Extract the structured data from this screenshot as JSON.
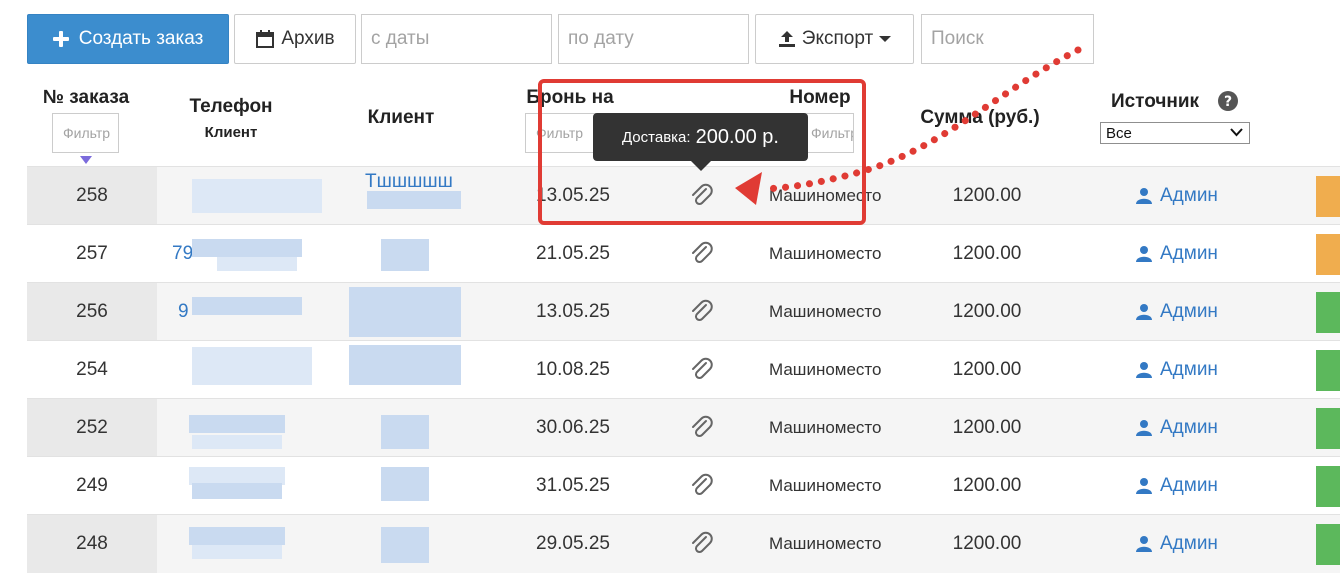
{
  "toolbar": {
    "create_label": "Создать заказ",
    "archive_label": "Архив",
    "date_from_placeholder": "с даты",
    "date_to_placeholder": "по дату",
    "export_label": "Экспорт",
    "search_placeholder": "Поиск"
  },
  "table": {
    "headers": {
      "order_no": "№ заказа",
      "phone": "Телефон",
      "phone_sub": "Клиент",
      "client": "Клиент",
      "booking": "Бронь на",
      "number": "Номер",
      "sum": "Сумма (руб.)",
      "source": "Источник"
    },
    "filter_placeholder": "Фильтр",
    "source_select_value": "Все",
    "rows": [
      {
        "id": "258",
        "phone": "",
        "client": "Тшшшшш",
        "date": "13.05.25",
        "place": "Машиноместо",
        "sum": "1200.00",
        "source": "Админ",
        "status_color": "#f0ad4e"
      },
      {
        "id": "257",
        "phone": "79",
        "client": "",
        "date": "21.05.25",
        "place": "Машиноместо",
        "sum": "1200.00",
        "source": "Админ",
        "status_color": "#f0ad4e"
      },
      {
        "id": "256",
        "phone": "9",
        "client": "",
        "date": "13.05.25",
        "place": "Машиноместо",
        "sum": "1200.00",
        "source": "Админ",
        "status_color": "#5cb85c"
      },
      {
        "id": "254",
        "phone": "",
        "client": "",
        "date": "10.08.25",
        "place": "Машиноместо",
        "sum": "1200.00",
        "source": "Админ",
        "status_color": "#5cb85c"
      },
      {
        "id": "252",
        "phone": "",
        "client": "",
        "date": "30.06.25",
        "place": "Машиноместо",
        "sum": "1200.00",
        "source": "Админ",
        "status_color": "#5cb85c"
      },
      {
        "id": "249",
        "phone": "",
        "client": "",
        "date": "31.05.25",
        "place": "Машиноместо",
        "sum": "1200.00",
        "source": "Админ",
        "status_color": "#5cb85c"
      },
      {
        "id": "248",
        "phone": "",
        "client": "",
        "date": "29.05.25",
        "place": "Машиноместо",
        "sum": "1200.00",
        "source": "Админ",
        "status_color": "#5cb85c"
      }
    ]
  },
  "tooltip": {
    "label": "Доставка:",
    "value": "200.00 р."
  },
  "colors": {
    "primary": "#3c8dce",
    "link": "#3379c4",
    "annotation": "#e03b34",
    "status_orange": "#f0ad4e",
    "status_green": "#5cb85c"
  },
  "icons": [
    "plus-icon",
    "calendar-icon",
    "upload-icon",
    "caret-down-icon",
    "help-icon",
    "sort-arrow-icon",
    "paperclip-icon",
    "user-icon"
  ]
}
